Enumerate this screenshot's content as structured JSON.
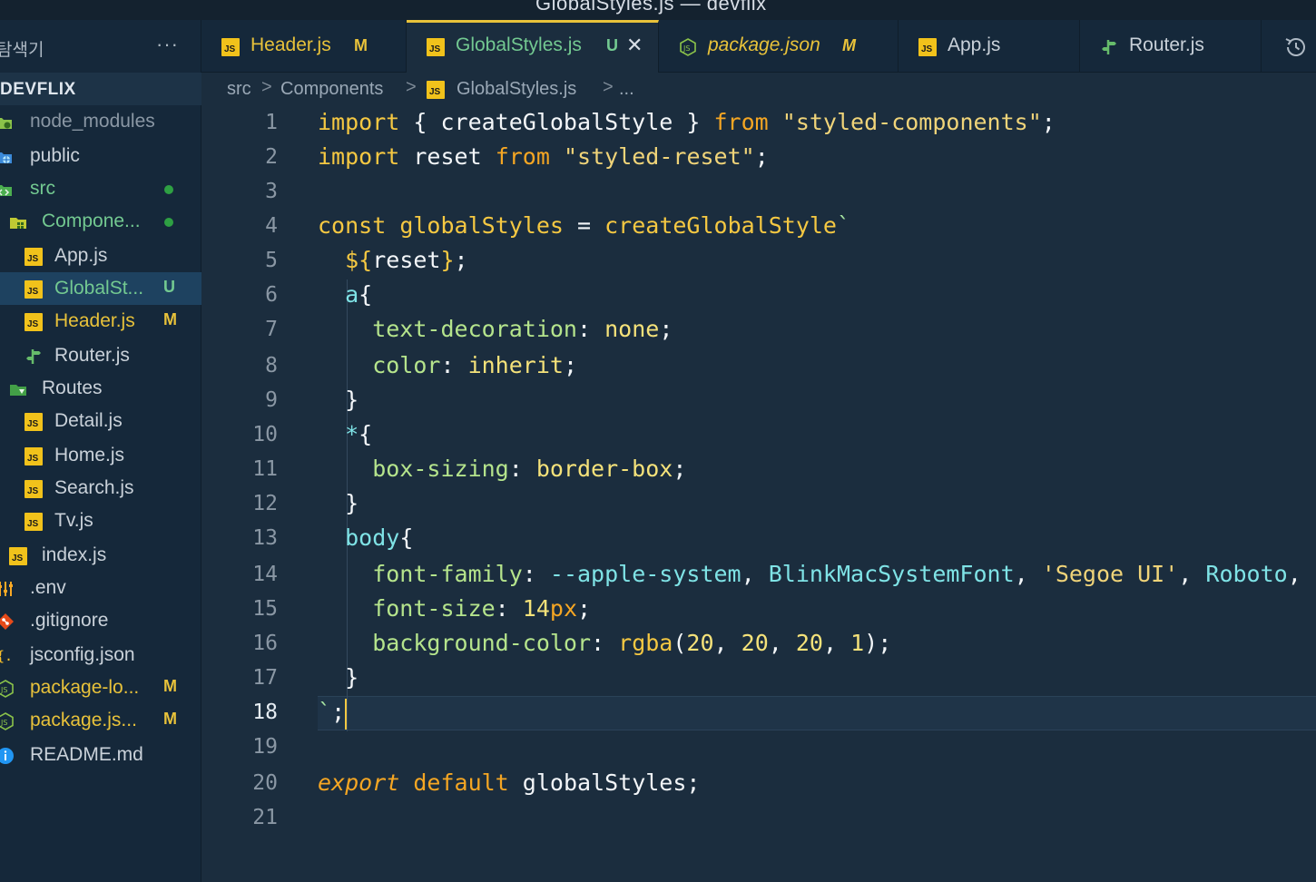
{
  "window": {
    "title": "GlobalStyles.js — devflix"
  },
  "sidebar": {
    "title": "탐색기",
    "more": "···",
    "root_label": "DEVFLIX",
    "items": [
      {
        "label": "node_modules",
        "badge": "",
        "dot": false,
        "icon": "node-folder-icon"
      },
      {
        "label": "public",
        "badge": "",
        "dot": false,
        "icon": "public-folder-icon"
      },
      {
        "label": "src",
        "badge": "",
        "dot": true,
        "icon": "src-folder-icon"
      },
      {
        "label": "Compone...",
        "badge": "",
        "dot": true,
        "icon": "components-folder-icon"
      },
      {
        "label": "App.js",
        "badge": "",
        "dot": false,
        "icon": "js-file-icon"
      },
      {
        "label": "GlobalSt...",
        "badge": "U",
        "dot": false,
        "icon": "js-file-icon"
      },
      {
        "label": "Header.js",
        "badge": "M",
        "dot": false,
        "icon": "js-file-icon"
      },
      {
        "label": "Router.js",
        "badge": "",
        "dot": false,
        "icon": "router-file-icon"
      },
      {
        "label": "Routes",
        "badge": "",
        "dot": false,
        "icon": "routes-folder-icon"
      },
      {
        "label": "Detail.js",
        "badge": "",
        "dot": false,
        "icon": "js-file-icon"
      },
      {
        "label": "Home.js",
        "badge": "",
        "dot": false,
        "icon": "js-file-icon"
      },
      {
        "label": "Search.js",
        "badge": "",
        "dot": false,
        "icon": "js-file-icon"
      },
      {
        "label": "Tv.js",
        "badge": "",
        "dot": false,
        "icon": "js-file-icon"
      },
      {
        "label": "index.js",
        "badge": "",
        "dot": false,
        "icon": "js-file-icon"
      },
      {
        "label": ".env",
        "badge": "",
        "dot": false,
        "icon": "env-file-icon"
      },
      {
        "label": ".gitignore",
        "badge": "",
        "dot": false,
        "icon": "git-icon"
      },
      {
        "label": "jsconfig.json",
        "badge": "",
        "dot": false,
        "icon": "json-file-icon"
      },
      {
        "label": "package-lo...",
        "badge": "M",
        "dot": false,
        "icon": "node-file-icon"
      },
      {
        "label": "package.js...",
        "badge": "M",
        "dot": false,
        "icon": "node-file-icon"
      },
      {
        "label": "README.md",
        "badge": "",
        "dot": false,
        "icon": "info-icon"
      }
    ]
  },
  "tabs": [
    {
      "label": "Header.js",
      "badge": "M",
      "icon": "js-file-icon"
    },
    {
      "label": "GlobalStyles.js",
      "badge": "U",
      "icon": "js-file-icon",
      "close": "✕"
    },
    {
      "label": "package.json",
      "badge": "M",
      "icon": "node-file-icon"
    },
    {
      "label": "App.js",
      "badge": "",
      "icon": "js-file-icon"
    },
    {
      "label": "Router.js",
      "badge": "",
      "icon": "router-file-icon"
    }
  ],
  "breadcrumb": {
    "parts": [
      "src",
      "Components",
      "GlobalStyles.js",
      "..."
    ],
    "separator": ">"
  },
  "editor": {
    "line_numbers": [
      "1",
      "2",
      "3",
      "4",
      "5",
      "6",
      "7",
      "8",
      "9",
      "10",
      "11",
      "12",
      "13",
      "14",
      "15",
      "16",
      "17",
      "18",
      "19",
      "20",
      "21"
    ],
    "current_line": "18",
    "lines": {
      "l1": [
        [
          "import",
          "kw2"
        ],
        [
          " { ",
          "punc"
        ],
        [
          "createGlobalStyle",
          "ident"
        ],
        [
          " } ",
          "punc"
        ],
        [
          "from",
          "kw"
        ],
        [
          " ",
          "punc"
        ],
        [
          "\"styled-components\"",
          "str"
        ],
        [
          ";",
          "punc"
        ]
      ],
      "l2": [
        [
          "import",
          "kw2"
        ],
        [
          " ",
          "punc"
        ],
        [
          "reset",
          "ident"
        ],
        [
          " ",
          "punc"
        ],
        [
          "from",
          "kw"
        ],
        [
          " ",
          "punc"
        ],
        [
          "\"styled-reset\"",
          "str"
        ],
        [
          ";",
          "punc"
        ]
      ],
      "l4": [
        [
          "const",
          "kw2"
        ],
        [
          " ",
          "punc"
        ],
        [
          "globalStyles",
          "fn"
        ],
        [
          " = ",
          "punc"
        ],
        [
          "createGlobalStyle",
          "fn"
        ],
        [
          "`",
          "tick"
        ]
      ],
      "l5": [
        [
          "  ${",
          "kw2"
        ],
        [
          "reset",
          "ident"
        ],
        [
          "}",
          "kw2"
        ],
        [
          ";",
          "punc"
        ]
      ],
      "l6": [
        [
          "  a",
          "tag"
        ],
        [
          "{",
          "punc"
        ]
      ],
      "l7": [
        [
          "    text-decoration",
          "prop"
        ],
        [
          ": ",
          "punc"
        ],
        [
          "none",
          "val"
        ],
        [
          ";",
          "punc"
        ]
      ],
      "l8": [
        [
          "    color",
          "prop"
        ],
        [
          ": ",
          "punc"
        ],
        [
          "inherit",
          "val"
        ],
        [
          ";",
          "punc"
        ]
      ],
      "l9": [
        [
          "  }",
          "punc"
        ]
      ],
      "l10": [
        [
          "  *",
          "tag"
        ],
        [
          "{",
          "punc"
        ]
      ],
      "l11": [
        [
          "    box-sizing",
          "prop"
        ],
        [
          ": ",
          "punc"
        ],
        [
          "border-box",
          "val"
        ],
        [
          ";",
          "punc"
        ]
      ],
      "l12": [
        [
          "  }",
          "punc"
        ]
      ],
      "l13": [
        [
          "  body",
          "tag"
        ],
        [
          "{",
          "punc"
        ]
      ],
      "l14": [
        [
          "    font-family",
          "prop"
        ],
        [
          ": ",
          "punc"
        ],
        [
          "--apple-system",
          "tag"
        ],
        [
          ", ",
          "punc"
        ],
        [
          "BlinkMacSystemFont",
          "tag"
        ],
        [
          ", ",
          "punc"
        ],
        [
          "'Segoe UI'",
          "str"
        ],
        [
          ", ",
          "punc"
        ],
        [
          "Roboto",
          "tag"
        ],
        [
          ", ",
          "punc"
        ]
      ],
      "l15": [
        [
          "    font-size",
          "prop"
        ],
        [
          ": ",
          "punc"
        ],
        [
          "14",
          "num"
        ],
        [
          "px",
          "unit"
        ],
        [
          ";",
          "punc"
        ]
      ],
      "l16": [
        [
          "    background-color",
          "prop"
        ],
        [
          ": ",
          "punc"
        ],
        [
          "rgba",
          "fn"
        ],
        [
          "(",
          "punc"
        ],
        [
          "20",
          "num"
        ],
        [
          ", ",
          "punc"
        ],
        [
          "20",
          "num"
        ],
        [
          ", ",
          "punc"
        ],
        [
          "20",
          "num"
        ],
        [
          ", ",
          "punc"
        ],
        [
          "1",
          "num"
        ],
        [
          ");",
          "punc"
        ]
      ],
      "l17": [
        [
          "  }",
          "punc"
        ]
      ],
      "l18": [
        [
          "`",
          "tick"
        ],
        [
          ";",
          "punc"
        ]
      ],
      "l20": [
        [
          "export",
          "kw italic"
        ],
        [
          " ",
          "punc"
        ],
        [
          "default",
          "kw"
        ],
        [
          " ",
          "punc"
        ],
        [
          "globalStyles",
          "ident"
        ],
        [
          ";",
          "punc"
        ]
      ]
    }
  },
  "colors": {
    "background": "#1b2d3e",
    "sidebar": "#15283a",
    "accent": "#e8c23a",
    "modified": "#e8c23a",
    "untracked": "#73c991",
    "selected_row": "#1e4260"
  }
}
